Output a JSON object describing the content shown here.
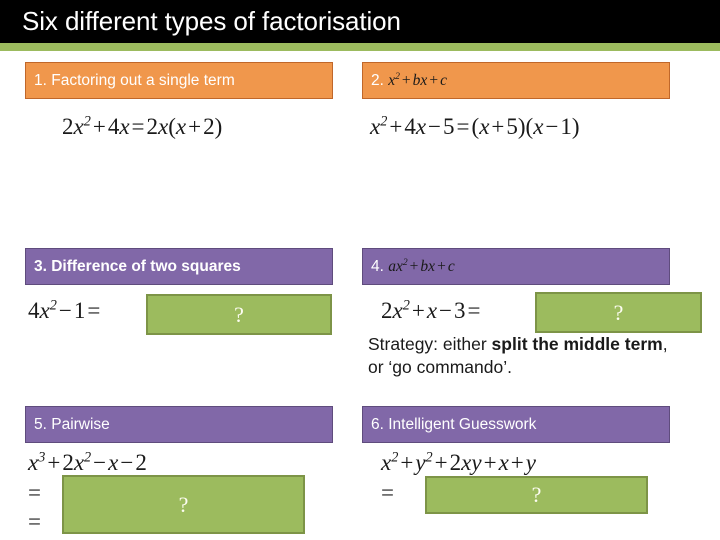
{
  "slide": {
    "title": "Six different types of factorisation",
    "colors": {
      "title_bar": "#000000",
      "accent_rule": "#9cbb5e",
      "orange_chip": "#f0974c",
      "orange_chip_border": "#c0672a",
      "purple_chip": "#8168a8",
      "purple_chip_border": "#5f4c7d",
      "answer_box": "#9cbb5e",
      "answer_box_border": "#7d9447",
      "text": "#1a1a1a"
    }
  },
  "items": [
    {
      "number": "1.",
      "heading": "1. Factoring out a single term",
      "heading_style": "orange",
      "equation_lines": [
        "2x² + 4x = 2x(x + 2)"
      ],
      "answer_placeholder": null
    },
    {
      "number": "2.",
      "heading": "2. x² + bx + c",
      "heading_style": "orange",
      "equation_lines": [
        "x² + 4x − 5 = (x + 5)(x − 1)"
      ],
      "answer_placeholder": null
    },
    {
      "number": "3.",
      "heading": "3. Difference of two squares",
      "heading_style": "purple",
      "equation_lines": [
        "4x² − 1 ="
      ],
      "answer_placeholder": "?"
    },
    {
      "number": "4.",
      "heading": "4. ax² + bx + c",
      "heading_style": "purple",
      "equation_lines": [
        "2x² + x − 3 ="
      ],
      "answer_placeholder": "?",
      "note_parts": {
        "lead": "Strategy: either ",
        "bold1": "split the middle term",
        "tail": ", or ‘go commando’."
      }
    },
    {
      "number": "5.",
      "heading": "5. Pairwise",
      "heading_style": "purple",
      "equation_lines": [
        "x³ + 2x² − x − 2",
        "=",
        "="
      ],
      "answer_placeholder": "?"
    },
    {
      "number": "6.",
      "heading": "6. Intelligent Guesswork",
      "heading_style": "purple",
      "equation_lines": [
        "x² + y² + 2xy + x + y",
        "="
      ],
      "answer_placeholder": "?"
    }
  ]
}
